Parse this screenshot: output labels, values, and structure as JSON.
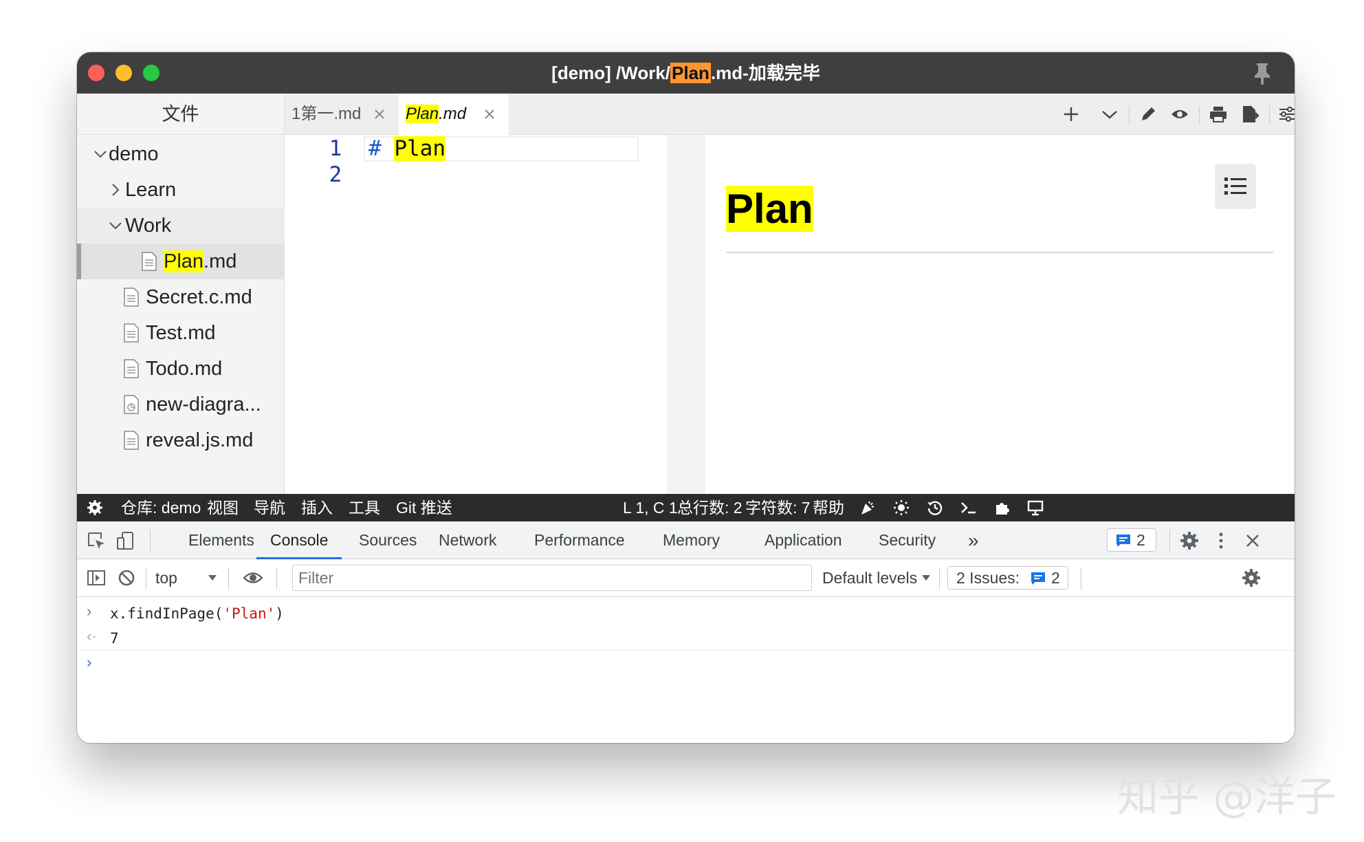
{
  "window": {
    "title_prefix": "[demo] /Work/",
    "title_highlight": "Plan",
    "title_suffix": ".md-加载完毕"
  },
  "sidebar": {
    "header": "文件",
    "items": [
      {
        "label": "demo",
        "type": "folder-open"
      },
      {
        "label": "Learn",
        "type": "folder-closed"
      },
      {
        "label": "Work",
        "type": "folder-open"
      },
      {
        "label_highlight": "Plan",
        "label_rest": ".md",
        "type": "file",
        "selected": true
      },
      {
        "label": "Secret.c.md",
        "type": "file"
      },
      {
        "label": "Test.md",
        "type": "file"
      },
      {
        "label": "Todo.md",
        "type": "file"
      },
      {
        "label": "new-diagra...",
        "type": "diagram-file"
      },
      {
        "label": "reveal.js.md",
        "type": "file"
      }
    ]
  },
  "tabs": [
    {
      "label": "1第一.md",
      "active": false
    },
    {
      "label_highlight": "Plan",
      "label_rest": ".md",
      "active": true
    }
  ],
  "toolbar_icons": [
    "plus-icon",
    "chevron-down-icon",
    "pencil-icon",
    "eye-icon",
    "printer-icon",
    "export-icon",
    "settings-sliders-icon"
  ],
  "editor": {
    "line_numbers": [
      "1",
      "2"
    ],
    "line1_hash": "#",
    "line1_text": "Plan"
  },
  "preview": {
    "heading": "Plan"
  },
  "statusbar": {
    "repo": "仓库: demo",
    "menus": [
      "视图",
      "导航",
      "插入",
      "工具",
      "Git 推送"
    ],
    "position": "L 1, C 1",
    "lines": "总行数: 2",
    "chars": "字符数: 7",
    "help": "帮助"
  },
  "devtools": {
    "tabs": [
      "Elements",
      "Console",
      "Sources",
      "Network",
      "Performance",
      "Memory",
      "Application",
      "Security"
    ],
    "more": "»",
    "active_tab": "Console",
    "message_count": "2",
    "context": "top",
    "filter_placeholder": "Filter",
    "levels": "Default levels",
    "issues_label": "2 Issues:",
    "issues_count": "2"
  },
  "console": {
    "input_code_pre": "x.findInPage(",
    "input_code_str": "'Plan'",
    "input_code_post": ")",
    "result": "7"
  },
  "watermark": "知乎 @洋子",
  "colors": {
    "highlight_yellow": "#ffff00",
    "highlight_orange": "#ff9632",
    "accent_blue": "#1a73e8",
    "titlebar": "#3f3f3f",
    "statusbar": "#2b2b2b"
  }
}
